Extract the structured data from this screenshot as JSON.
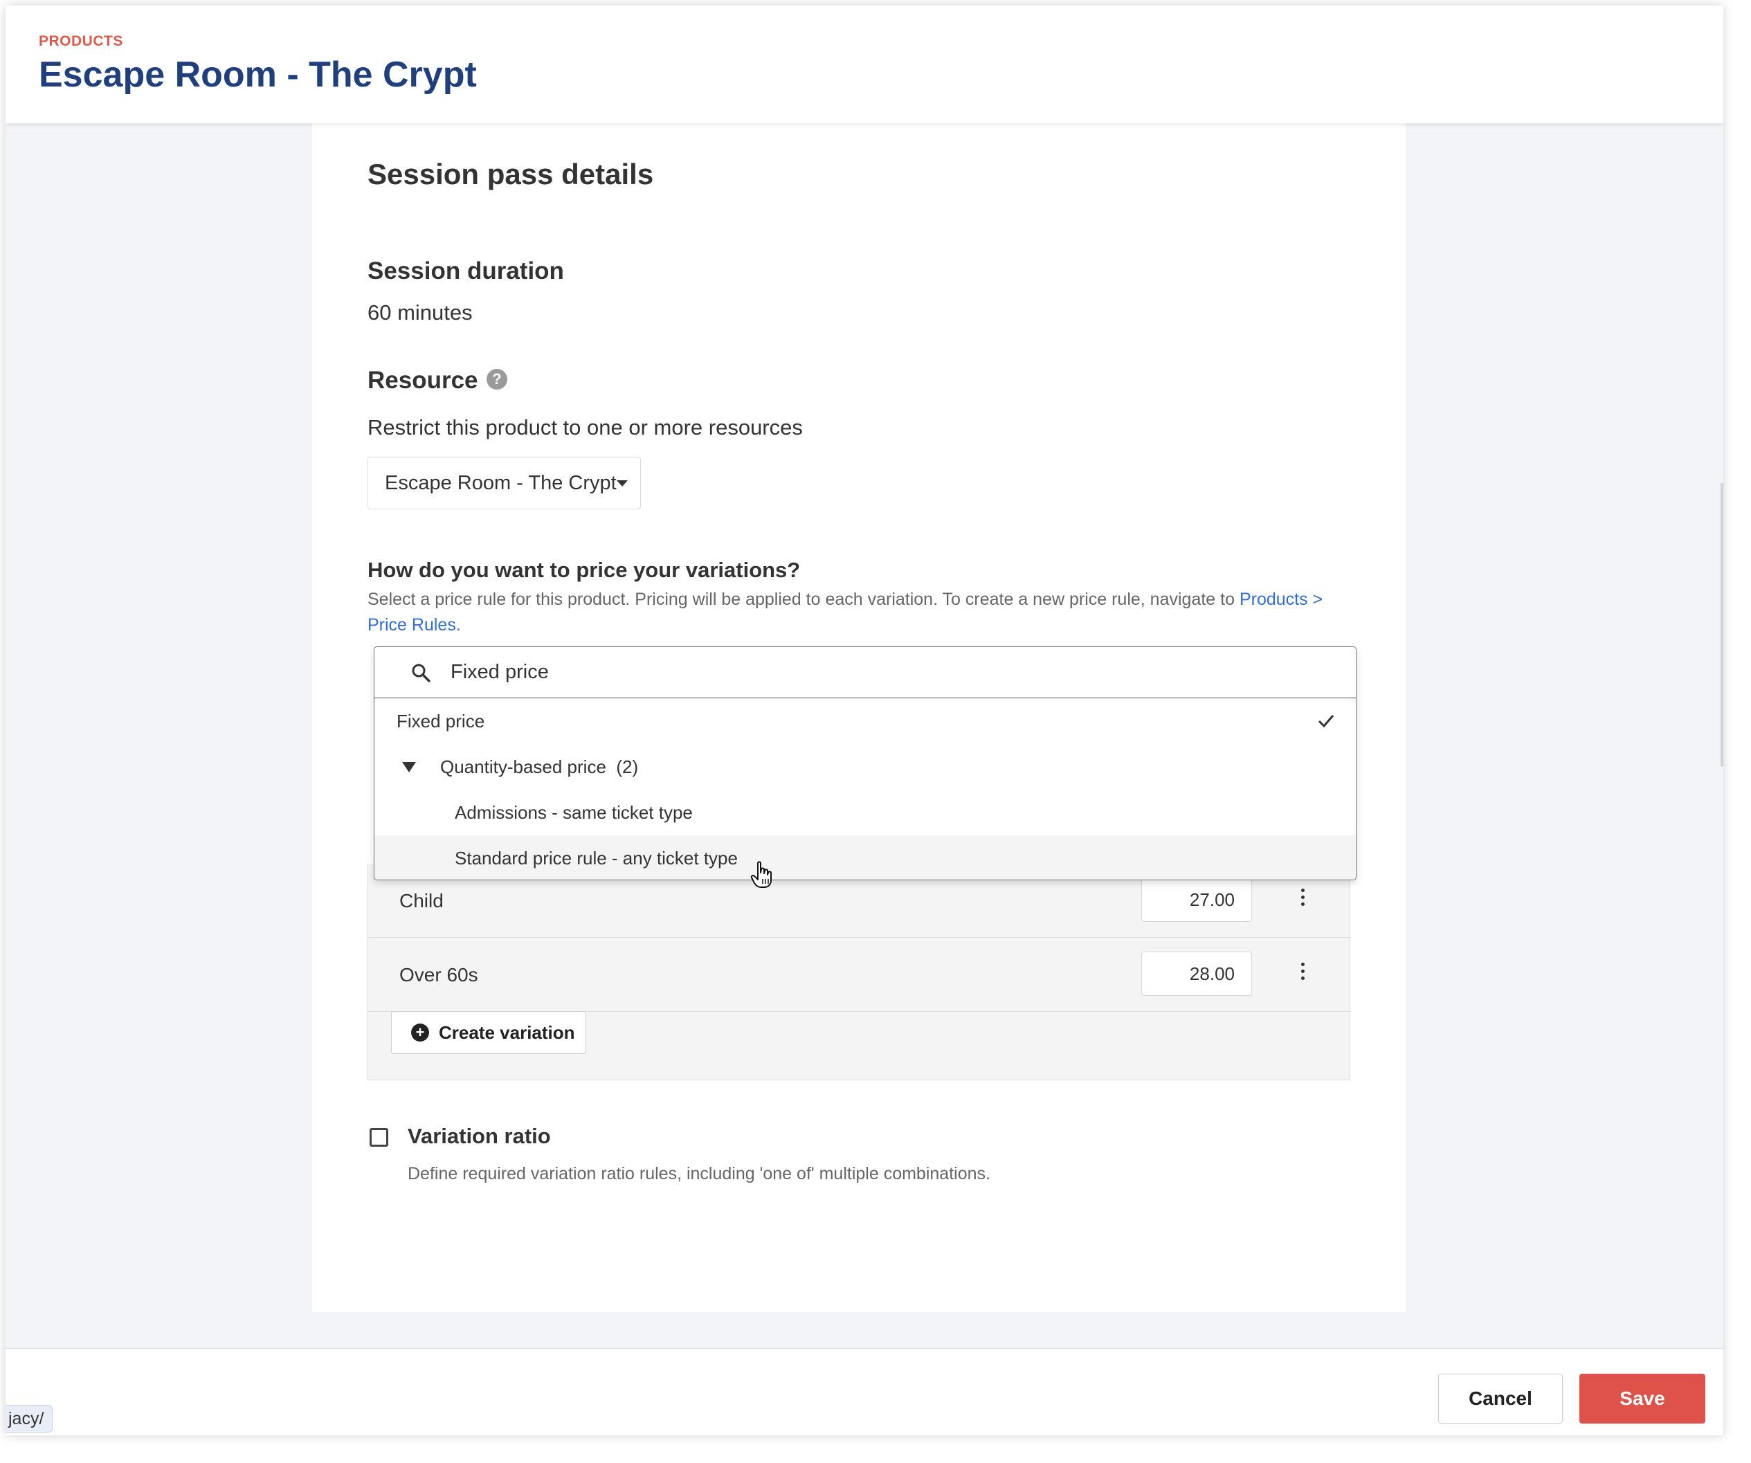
{
  "header": {
    "breadcrumb": "PRODUCTS",
    "title": "Escape Room - The Crypt"
  },
  "card": {
    "section_title": "Session pass details",
    "session_duration": {
      "label": "Session duration",
      "value": "60 minutes"
    },
    "resource": {
      "label": "Resource",
      "help_icon": "?",
      "description": "Restrict this product to one or more resources",
      "selected": "Escape Room - The Crypt"
    },
    "pricing": {
      "question": "How do you want to price your variations?",
      "description": "Select a price rule for this product. Pricing will be applied to each variation. To create a new price rule, navigate to ",
      "link_text": "Products > Price Rules."
    },
    "variations": [
      {
        "name": "Child",
        "price": "27.00"
      },
      {
        "name": "Over 60s",
        "price": "28.00"
      }
    ],
    "create_variation_label": "Create variation",
    "variation_ratio": {
      "label": "Variation ratio",
      "checked": false,
      "description": "Define required variation ratio rules, including 'one of' multiple combinations."
    }
  },
  "dropdown": {
    "search_value": "Fixed price",
    "options": {
      "fixed": "Fixed price",
      "group": "Quantity-based price",
      "group_count": "(2)",
      "child1": "Admissions - same ticket type",
      "child2": "Standard price rule - any ticket type"
    },
    "selected": "Fixed price",
    "hovered": "Standard price rule - any ticket type"
  },
  "footer": {
    "cancel_label": "Cancel",
    "save_label": "Save",
    "status_url": "jacy/"
  },
  "colors": {
    "title": "#1f3f7f",
    "breadcrumb": "#e05a4b",
    "link": "#2f6fd6",
    "save": "#df524a"
  }
}
